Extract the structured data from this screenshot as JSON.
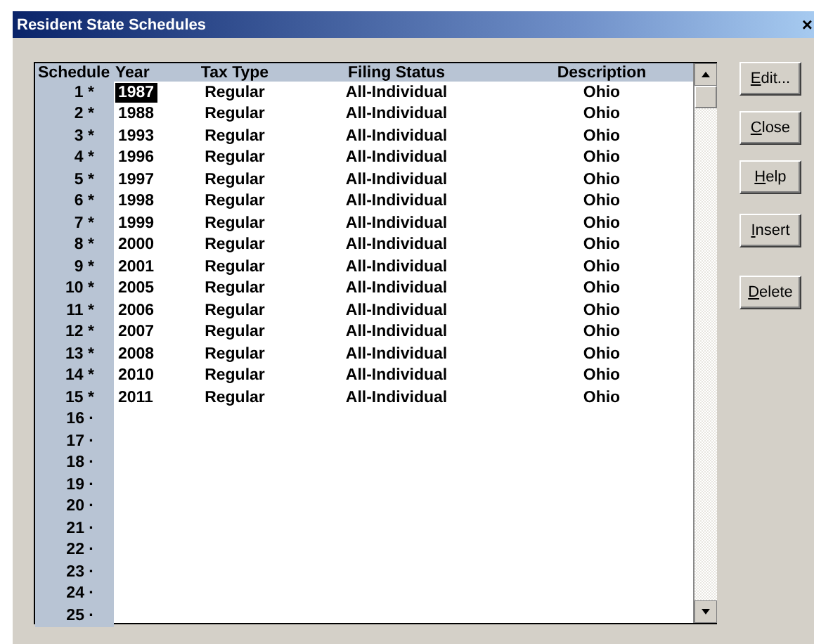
{
  "window": {
    "title": "Resident State Schedules",
    "close_glyph": "×"
  },
  "table": {
    "columns": [
      "Schedule",
      "Year",
      "Tax Type",
      "Filing Status",
      "Description"
    ],
    "rows": [
      {
        "schedule": "1 *",
        "year": "1987",
        "tax_type": "Regular",
        "filing_status": "All-Individual",
        "description": "Ohio",
        "selected": true
      },
      {
        "schedule": "2 *",
        "year": "1988",
        "tax_type": "Regular",
        "filing_status": "All-Individual",
        "description": "Ohio",
        "selected": false
      },
      {
        "schedule": "3 *",
        "year": "1993",
        "tax_type": "Regular",
        "filing_status": "All-Individual",
        "description": "Ohio",
        "selected": false
      },
      {
        "schedule": "4 *",
        "year": "1996",
        "tax_type": "Regular",
        "filing_status": "All-Individual",
        "description": "Ohio",
        "selected": false
      },
      {
        "schedule": "5 *",
        "year": "1997",
        "tax_type": "Regular",
        "filing_status": "All-Individual",
        "description": "Ohio",
        "selected": false
      },
      {
        "schedule": "6 *",
        "year": "1998",
        "tax_type": "Regular",
        "filing_status": "All-Individual",
        "description": "Ohio",
        "selected": false
      },
      {
        "schedule": "7 *",
        "year": "1999",
        "tax_type": "Regular",
        "filing_status": "All-Individual",
        "description": "Ohio",
        "selected": false
      },
      {
        "schedule": "8 *",
        "year": "2000",
        "tax_type": "Regular",
        "filing_status": "All-Individual",
        "description": "Ohio",
        "selected": false
      },
      {
        "schedule": "9 *",
        "year": "2001",
        "tax_type": "Regular",
        "filing_status": "All-Individual",
        "description": "Ohio",
        "selected": false
      },
      {
        "schedule": "10 *",
        "year": "2005",
        "tax_type": "Regular",
        "filing_status": "All-Individual",
        "description": "Ohio",
        "selected": false
      },
      {
        "schedule": "11 *",
        "year": "2006",
        "tax_type": "Regular",
        "filing_status": "All-Individual",
        "description": "Ohio",
        "selected": false
      },
      {
        "schedule": "12 *",
        "year": "2007",
        "tax_type": "Regular",
        "filing_status": "All-Individual",
        "description": "Ohio",
        "selected": false
      },
      {
        "schedule": "13 *",
        "year": "2008",
        "tax_type": "Regular",
        "filing_status": "All-Individual",
        "description": "Ohio",
        "selected": false
      },
      {
        "schedule": "14 *",
        "year": "2010",
        "tax_type": "Regular",
        "filing_status": "All-Individual",
        "description": "Ohio",
        "selected": false
      },
      {
        "schedule": "15 *",
        "year": "2011",
        "tax_type": "Regular",
        "filing_status": "All-Individual",
        "description": "Ohio",
        "selected": false
      },
      {
        "schedule": "16 ·"
      },
      {
        "schedule": "17 ·"
      },
      {
        "schedule": "18 ·"
      },
      {
        "schedule": "19 ·"
      },
      {
        "schedule": "20 ·"
      },
      {
        "schedule": "21 ·"
      },
      {
        "schedule": "22 ·"
      },
      {
        "schedule": "23 ·"
      },
      {
        "schedule": "24 ·"
      },
      {
        "schedule": "25 ·"
      }
    ]
  },
  "buttons": [
    {
      "access_key": "E",
      "rest": "dit..."
    },
    {
      "access_key": "C",
      "rest": "lose"
    },
    {
      "access_key": "H",
      "rest": "elp"
    },
    {
      "access_key": "I",
      "rest": "nsert"
    },
    {
      "access_key": "D",
      "rest": "elete"
    }
  ]
}
